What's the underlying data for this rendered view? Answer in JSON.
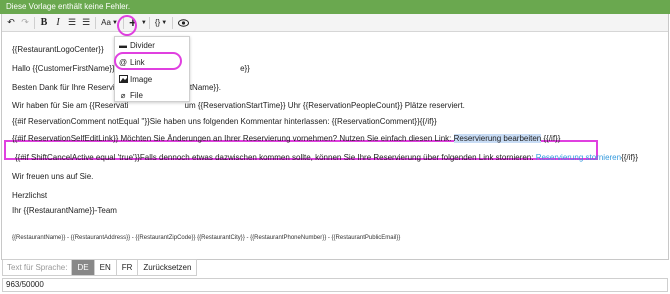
{
  "status": {
    "message": "Diese Vorlage enthält keine Fehler."
  },
  "toolbar": {
    "undo_icon": "undo-icon",
    "redo_icon": "redo-icon",
    "bold": "B",
    "italic": "I",
    "bullet_list": "☰",
    "numbered_list": "☰",
    "font_size": "Aa",
    "insert": "+",
    "variables": "{}",
    "preview_icon": "eye-icon"
  },
  "insert_menu": {
    "items": [
      {
        "label": "Divider",
        "icon": "divider-icon"
      },
      {
        "label": "Link",
        "icon": "at-icon"
      },
      {
        "label": "Image",
        "icon": "image-icon"
      },
      {
        "label": "File",
        "icon": "paperclip-icon"
      }
    ]
  },
  "content": {
    "logo": "{{RestaurantLogoCenter}}",
    "greeting_a": "Hallo {{CustomerFirstName}} {{C",
    "greeting_b": "e}}",
    "thanks_a": "Besten Dank für Ihre Reservier",
    "thanks_b": "tName}}.",
    "reserved_a": "Wir haben für Sie am {{Reservati",
    "reserved_b": "um {{ReservationStartTime}} Uhr {{ReservationPeopleCount}} Plätze reserviert.",
    "comment": "{{#if ReservationComment notEqual ''}}Sie haben uns folgenden Kommentar hinterlassen: {{ReservationComment}}{{/if}}",
    "selfedit_prefix": "{{#if ReservationSelfEditLink}} Möchten Sie Änderungen an Ihrer Reservierung vornehmen? Nutzen Sie einfach diesen Link:",
    "selfedit_link": "Reservierung bearbeiten",
    "selfedit_suffix": "{{/if}}",
    "shift_prefix": "{{#if ShiftCancelActive equal 'true'}}Falls dennoch etwas dazwischen kommen sollte, können Sie Ihre Reservierung über folgenden Link stornieren:",
    "shift_link": "Reservierung stornieren",
    "shift_suffix": "{{/if}}",
    "looking_forward": "Wir freuen uns auf Sie.",
    "regards": "Herzlichst",
    "team": "Ihr {{RestaurantName}}-Team",
    "footer": "{{RestaurantName}} - {{RestaurantAddress}} - {{RestaurantZipCode}} {{RestaurantCity}} - {{RestaurantPhoneNumber}} - {{RestaurantPublicEmail}}"
  },
  "language": {
    "label": "Text für Sprache:",
    "options": [
      "DE",
      "EN",
      "FR"
    ],
    "active": "DE",
    "reset": "Zurücksetzen"
  },
  "counter": "963/50000",
  "colors": {
    "status_bg": "#6aa84f",
    "highlight": "#e040e0",
    "link": "#3399dd"
  }
}
